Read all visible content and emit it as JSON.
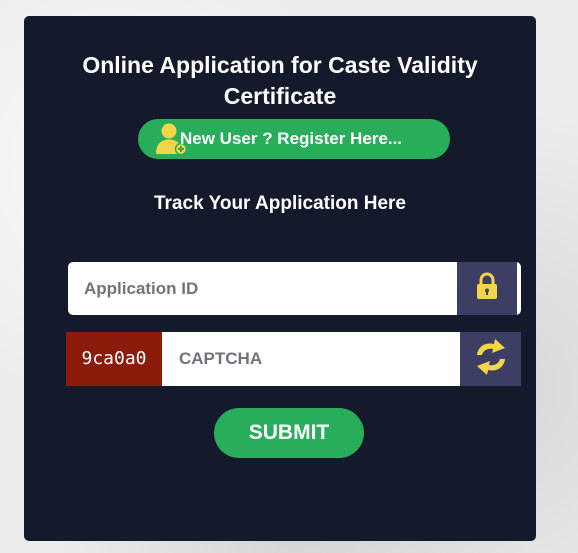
{
  "form": {
    "title_line1": "Online Application for Caste Validity",
    "title_line2": "Certificate",
    "register_label": "New User ? Register Here...",
    "track_title": "Track Your Application Here",
    "application_id_placeholder": "Application ID",
    "captcha_code": "9ca0a0",
    "captcha_placeholder": "CAPTCHA",
    "submit_label": "SUBMIT"
  },
  "icons": {
    "register": "add-user-icon",
    "lock": "lock-icon",
    "refresh": "refresh-icon"
  },
  "colors": {
    "card_background": "#141a2b",
    "accent_green": "#28ad5a",
    "addon_background": "#3c3e63",
    "icon_yellow": "#f3d54a",
    "captcha_background": "#8b1c0b"
  }
}
